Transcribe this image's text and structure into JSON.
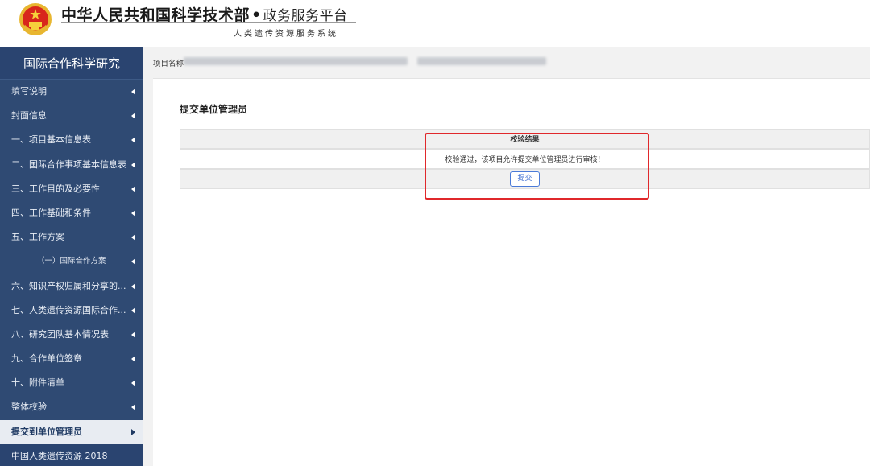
{
  "header": {
    "brand_main": "中华人民共和国科学技术部",
    "brand_dot": "•",
    "brand_sub": "政务服务平台",
    "system_name": "人类遗传资源服务系统"
  },
  "sidebar": {
    "title": "国际合作科学研究",
    "items": [
      {
        "label": "填写说明"
      },
      {
        "label": "封面信息"
      },
      {
        "label": "一、项目基本信息表"
      },
      {
        "label": "二、国际合作事项基本信息表"
      },
      {
        "label": "三、工作目的及必要性"
      },
      {
        "label": "四、工作基础和条件"
      },
      {
        "label": "五、工作方案"
      },
      {
        "label": "（一）国际合作方案"
      },
      {
        "label": "六、知识产权归属和分享的..."
      },
      {
        "label": "七、人类遗传资源国际合作..."
      },
      {
        "label": "八、研究团队基本情况表"
      },
      {
        "label": "九、合作单位签章"
      },
      {
        "label": "十、附件清单"
      },
      {
        "label": "整体校验"
      },
      {
        "label": "提交到单位管理员"
      },
      {
        "label": "中国人类遗传资源 2018"
      }
    ]
  },
  "main": {
    "breadcrumb_label": "项目名称",
    "panel_title": "提交单位管理员",
    "table": {
      "header": "校验结果",
      "message": "校验通过，该项目允许提交单位管理员进行审核！",
      "submit_label": "提交"
    }
  },
  "colors": {
    "sidebar_bg": "#2f4a73",
    "highlight": "#e0282b",
    "button_border": "#4a7ad8"
  }
}
